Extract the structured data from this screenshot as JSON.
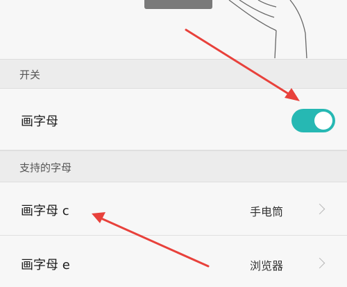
{
  "switch_section": {
    "header": "开关"
  },
  "toggle_row": {
    "label": "画字母",
    "enabled": true
  },
  "letters_section": {
    "header": "支持的字母"
  },
  "letters": [
    {
      "label": "画字母 c",
      "app": "手电筒"
    },
    {
      "label": "画字母 e",
      "app": "浏览器"
    }
  ],
  "colors": {
    "accent": "#26b8b3",
    "arrow": "#e8413b"
  },
  "icons": [
    "hand-gesture-illustration",
    "chevron-right-icon"
  ]
}
